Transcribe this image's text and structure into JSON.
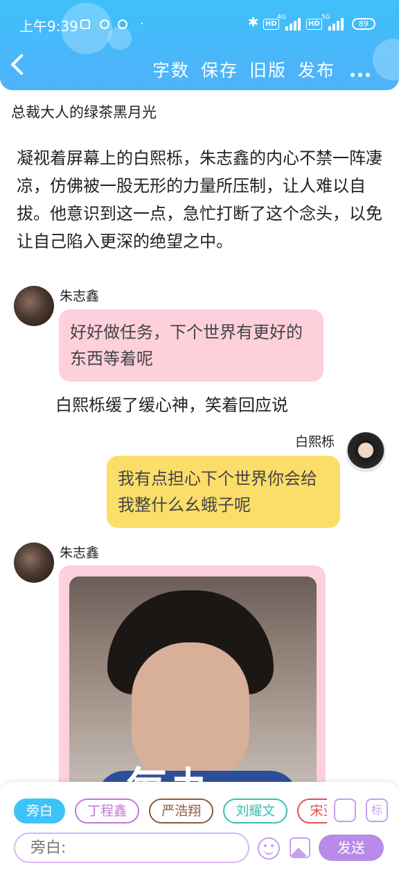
{
  "status_bar": {
    "time": "上午9:39",
    "dot": "·",
    "bluetooth": "✱",
    "hd1": "HD",
    "net1": "4G",
    "hd2": "HD",
    "net2": "5G",
    "battery": "89"
  },
  "toolbar": {
    "wordcount_label": "字数",
    "save_label": "保存",
    "old_version_label": "旧版",
    "publish_label": "发布"
  },
  "story": {
    "title": "总裁大人的绿茶黑月光",
    "paragraph": "凝视着屏幕上的白熙栎，朱志鑫的内心不禁一阵凄凉，仿佛被一股无形的力量所压制，让人难以自拔。他意识到这一点，急忙打断了这个念头，以免让自己陷入更深的绝望之中。"
  },
  "messages": [
    {
      "speaker": "朱志鑫",
      "text": "好好做任务，下个世界有更好的东西等着呢"
    },
    {
      "narration": "白熙栎缓了缓心神，笑着回应说"
    },
    {
      "speaker": "白熙栎",
      "text": "我有点担心下个世界你会给我整什么幺蛾子呢"
    },
    {
      "speaker": "朱志鑫",
      "image_caption": "每九"
    }
  ],
  "composer": {
    "roles": [
      {
        "label": "旁白",
        "color": "#3ec3f8"
      },
      {
        "label": "丁程鑫",
        "color": "#c077d9"
      },
      {
        "label": "严浩翔",
        "color": "#8a5a3c"
      },
      {
        "label": "刘耀文",
        "color": "#3dbcb0"
      },
      {
        "label": "宋亚",
        "color": "#e05050"
      }
    ],
    "role_icon_label": "标",
    "placeholder": "旁白:",
    "send_label": "发送"
  }
}
